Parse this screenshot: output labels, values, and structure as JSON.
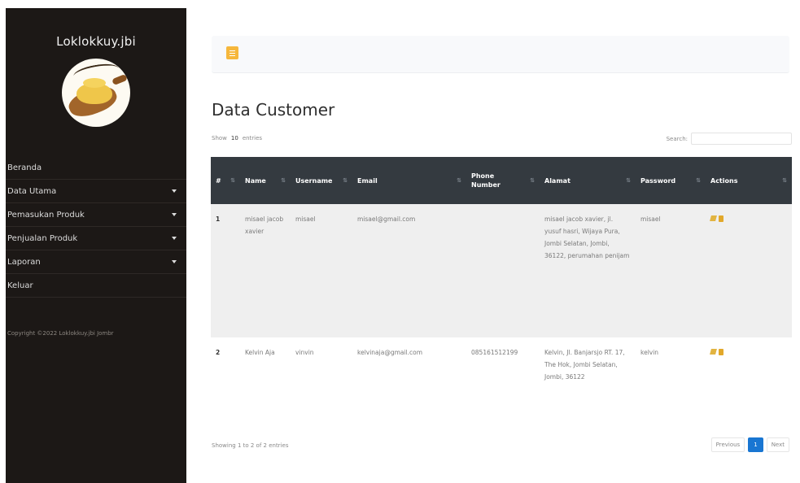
{
  "sidebar": {
    "brand": "Loklokkuy.jbi",
    "menu": [
      {
        "label": "Beranda",
        "has_caret": false
      },
      {
        "label": "Data Utama",
        "has_caret": true
      },
      {
        "label": "Pemasukan Produk",
        "has_caret": true
      },
      {
        "label": "Penjualan Produk",
        "has_caret": true
      },
      {
        "label": "Laporan",
        "has_caret": true
      },
      {
        "label": "Keluar",
        "has_caret": false
      }
    ],
    "copyright": "Copyright ©2022 Loklokkuy.jbi Jombr"
  },
  "topbar": {
    "toggle_icon": "hamburger-icon",
    "accent": "#f6b73c"
  },
  "page": {
    "title": "Data Customer"
  },
  "controls": {
    "show_label": "Show",
    "length_value": "10",
    "entries_label": "entries",
    "search_label": "Search:",
    "search_value": ""
  },
  "table": {
    "columns": [
      "#",
      "Name",
      "Username",
      "Email",
      "Phone Number",
      "Alamat",
      "Password",
      "Actions"
    ],
    "rows": [
      {
        "num": "1",
        "name": "misael jacob xavier",
        "username": "misael",
        "email": "misael@gmail.com",
        "phone": "",
        "alamat": "misael jacob xavier, jl. yusuf hasri, Wijaya Pura, Jombi Selatan, Jombi, 36122, perumahan penijam",
        "password": "misael"
      },
      {
        "num": "2",
        "name": "Kelvin Aja",
        "username": "vinvin",
        "email": "kelvinaja@gmail.com",
        "phone": "085161512199",
        "alamat": "Kelvin, Jl. Banjarsjo RT. 17, The Hok, Jombi Selatan, Jombi, 36122",
        "password": "kelvin"
      }
    ]
  },
  "footer": {
    "info": "Showing 1 to 2 of 2 entries",
    "previous": "Previous",
    "page": "1",
    "next": "Next",
    "active_color": "#1976d2"
  }
}
